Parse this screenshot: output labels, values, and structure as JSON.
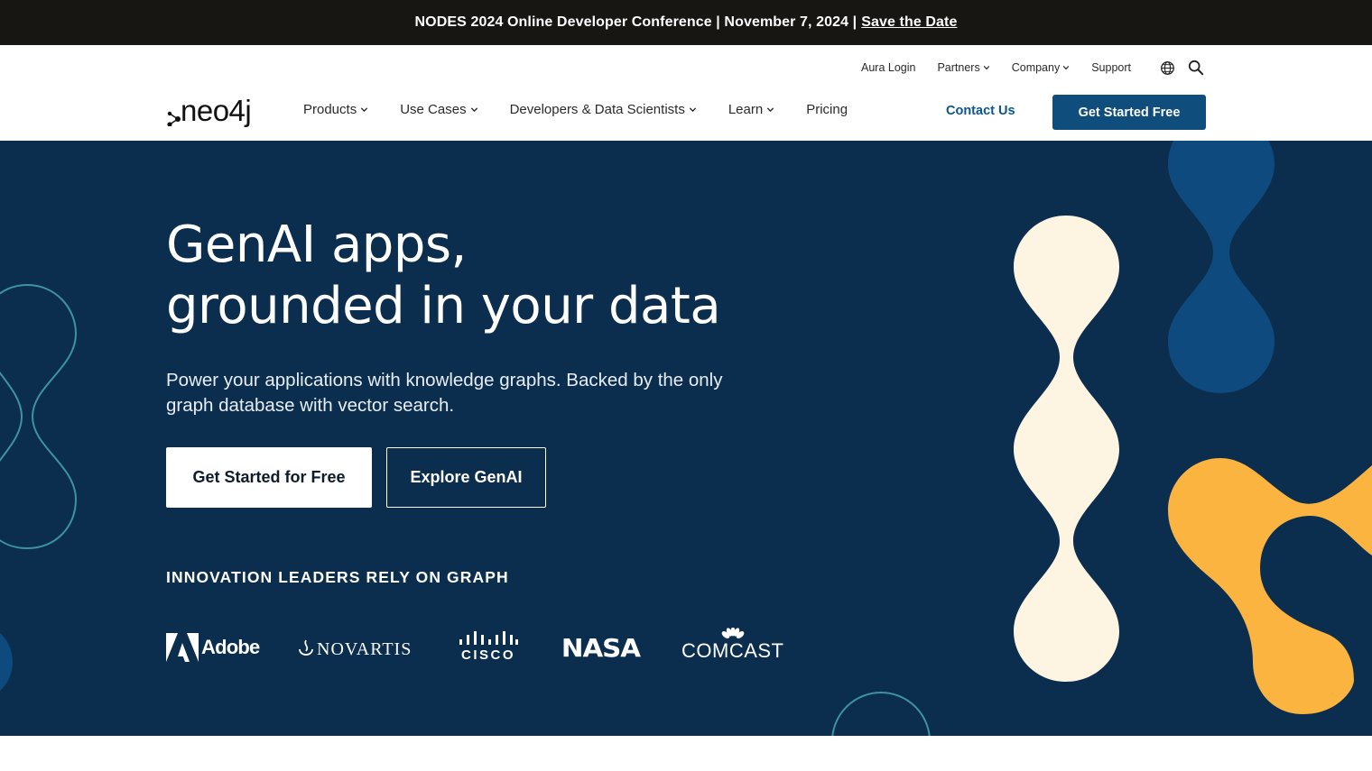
{
  "announcement": {
    "text": "NODES 2024 Online Developer Conference | November 7, 2024 |",
    "link_label": "Save the Date"
  },
  "utility_nav": {
    "items": [
      {
        "label": "Aura Login",
        "has_dropdown": false
      },
      {
        "label": "Partners",
        "has_dropdown": true
      },
      {
        "label": "Company",
        "has_dropdown": true
      },
      {
        "label": "Support",
        "has_dropdown": false
      }
    ],
    "icons": [
      "globe-icon",
      "search-icon"
    ]
  },
  "main_nav": {
    "logo_text": "neo4j",
    "items": [
      {
        "label": "Products",
        "has_dropdown": true
      },
      {
        "label": "Use Cases",
        "has_dropdown": true
      },
      {
        "label": "Developers & Data Scientists",
        "has_dropdown": true
      },
      {
        "label": "Learn",
        "has_dropdown": true
      },
      {
        "label": "Pricing",
        "has_dropdown": false
      }
    ],
    "contact_label": "Contact Us",
    "cta_label": "Get Started Free"
  },
  "hero": {
    "headline_line1": "GenAI apps,",
    "headline_line2": "grounded in your data",
    "subhead": "Power your applications with knowledge graphs. Backed by the only graph database with vector search.",
    "primary_button": "Get Started for Free",
    "secondary_button": "Explore GenAI",
    "leaders_heading": "INNOVATION LEADERS RELY ON GRAPH",
    "customer_logos": [
      "Adobe",
      "NOVARTIS",
      "CISCO",
      "NASA",
      "COMCAST"
    ]
  },
  "colors": {
    "announcement_bg": "#181613",
    "hero_bg": "#0b2e4e",
    "cta_bg": "#0e4d7c",
    "contact_text": "#0b5590",
    "cream_shape": "#fdf5e1",
    "blue_shape": "#0f4a7e",
    "yellow_shape": "#fbb43f",
    "teal_outline": "#3d93a2"
  }
}
